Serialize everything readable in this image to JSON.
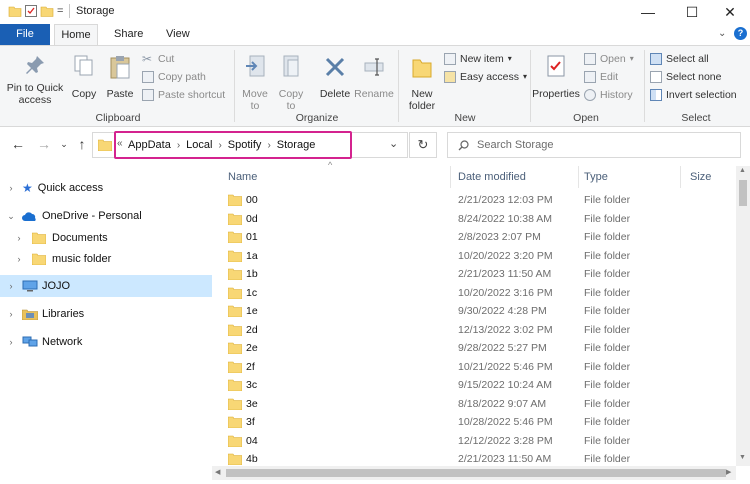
{
  "window": {
    "title": "Storage",
    "qat_dropdown": "="
  },
  "controls": {
    "minimize": "—",
    "maximize": "☐",
    "close": "✕"
  },
  "tabs": [
    {
      "label": "File"
    },
    {
      "label": "Home"
    },
    {
      "label": "Share"
    },
    {
      "label": "View"
    }
  ],
  "ribbon": {
    "clipboard": {
      "pin_label": "Pin to Quick access",
      "copy_label": "Copy",
      "paste_label": "Paste",
      "cut_label": "Cut",
      "copy_path_label": "Copy path",
      "paste_shortcut_label": "Paste shortcut",
      "group_label": "Clipboard"
    },
    "organize": {
      "move_label": "Move to",
      "copy_to_label": "Copy to",
      "delete_label": "Delete",
      "rename_label": "Rename",
      "group_label": "Organize"
    },
    "new": {
      "new_folder_label": "New folder",
      "new_item_label": "New item",
      "easy_access_label": "Easy access",
      "group_label": "New"
    },
    "open": {
      "properties_label": "Properties",
      "open_label": "Open",
      "edit_label": "Edit",
      "history_label": "History",
      "group_label": "Open"
    },
    "select": {
      "select_all_label": "Select all",
      "select_none_label": "Select none",
      "invert_label": "Invert selection",
      "group_label": "Select"
    }
  },
  "address": {
    "crumbs": [
      "AppData",
      "Local",
      "Spotify",
      "Storage"
    ],
    "overflow": "«",
    "search_placeholder": "Search Storage",
    "highlight_color": "#d4238f"
  },
  "nav": {
    "items": [
      {
        "label": "Quick access"
      },
      {
        "label": "OneDrive - Personal"
      },
      {
        "label": "Documents"
      },
      {
        "label": "music folder"
      },
      {
        "label": "JOJO"
      },
      {
        "label": "Libraries"
      },
      {
        "label": "Network"
      }
    ]
  },
  "columns": {
    "name": "Name",
    "date": "Date modified",
    "type": "Type",
    "size": "Size"
  },
  "files": [
    {
      "name": "00",
      "date": "2/21/2023 12:03 PM",
      "type": "File folder"
    },
    {
      "name": "0d",
      "date": "8/24/2022 10:38 AM",
      "type": "File folder"
    },
    {
      "name": "01",
      "date": "2/8/2023 2:07 PM",
      "type": "File folder"
    },
    {
      "name": "1a",
      "date": "10/20/2022 3:20 PM",
      "type": "File folder"
    },
    {
      "name": "1b",
      "date": "2/21/2023 11:50 AM",
      "type": "File folder"
    },
    {
      "name": "1c",
      "date": "10/20/2022 3:16 PM",
      "type": "File folder"
    },
    {
      "name": "1e",
      "date": "9/30/2022 4:28 PM",
      "type": "File folder"
    },
    {
      "name": "2d",
      "date": "12/13/2022 3:02 PM",
      "type": "File folder"
    },
    {
      "name": "2e",
      "date": "9/28/2022 5:27 PM",
      "type": "File folder"
    },
    {
      "name": "2f",
      "date": "10/21/2022 5:46 PM",
      "type": "File folder"
    },
    {
      "name": "3c",
      "date": "9/15/2022 10:24 AM",
      "type": "File folder"
    },
    {
      "name": "3e",
      "date": "8/18/2022 9:07 AM",
      "type": "File folder"
    },
    {
      "name": "3f",
      "date": "10/28/2022 5:46 PM",
      "type": "File folder"
    },
    {
      "name": "04",
      "date": "12/12/2022 3:28 PM",
      "type": "File folder"
    },
    {
      "name": "4b",
      "date": "2/21/2023 11:50 AM",
      "type": "File folder"
    }
  ]
}
